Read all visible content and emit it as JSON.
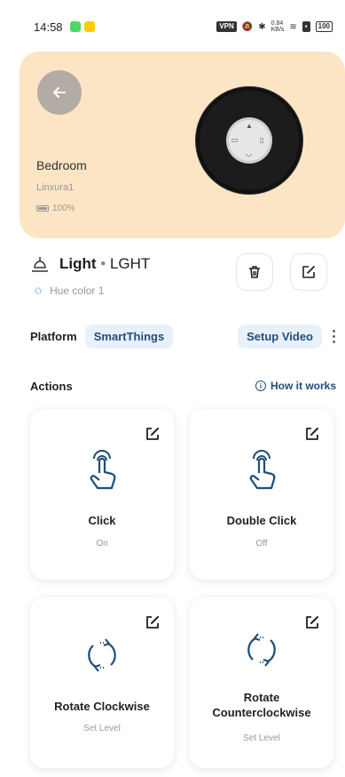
{
  "status_bar": {
    "time": "14:58",
    "vpn": "VPN",
    "net_speed": "0.84\nKB/s",
    "battery": "100"
  },
  "device": {
    "room": "Bedroom",
    "model": "Linxura1",
    "battery": "100%",
    "name": "Light",
    "separator": "•",
    "type": "LGHT",
    "subtitle": "Hue color 1"
  },
  "platform": {
    "label": "Platform",
    "value": "SmartThings",
    "setup_video": "Setup Video"
  },
  "actions": {
    "title": "Actions",
    "how_it_works": "How it works",
    "items": [
      {
        "title": "Click",
        "value": "On"
      },
      {
        "title": "Double Click",
        "value": "Off"
      },
      {
        "title": "Rotate Clockwise",
        "value": "Set Level"
      },
      {
        "title": "Rotate Counterclockwise",
        "value": "Set Level"
      }
    ]
  },
  "colors": {
    "hero_bg": "#fbe5c4",
    "chip_bg": "#e8f1fb",
    "accent_text": "#1f4e79",
    "back_button": "#b3aca4"
  },
  "icons": {
    "back": "arrow-left-icon",
    "lamp": "lamp-icon",
    "star": "star-icon",
    "trash": "trash-icon",
    "edit": "edit-icon",
    "info": "info-icon",
    "tap": "tap-hand-icon",
    "rotate_cw": "rotate-clockwise-icon",
    "rotate_ccw": "rotate-counterclockwise-icon",
    "more": "more-vertical-icon"
  }
}
